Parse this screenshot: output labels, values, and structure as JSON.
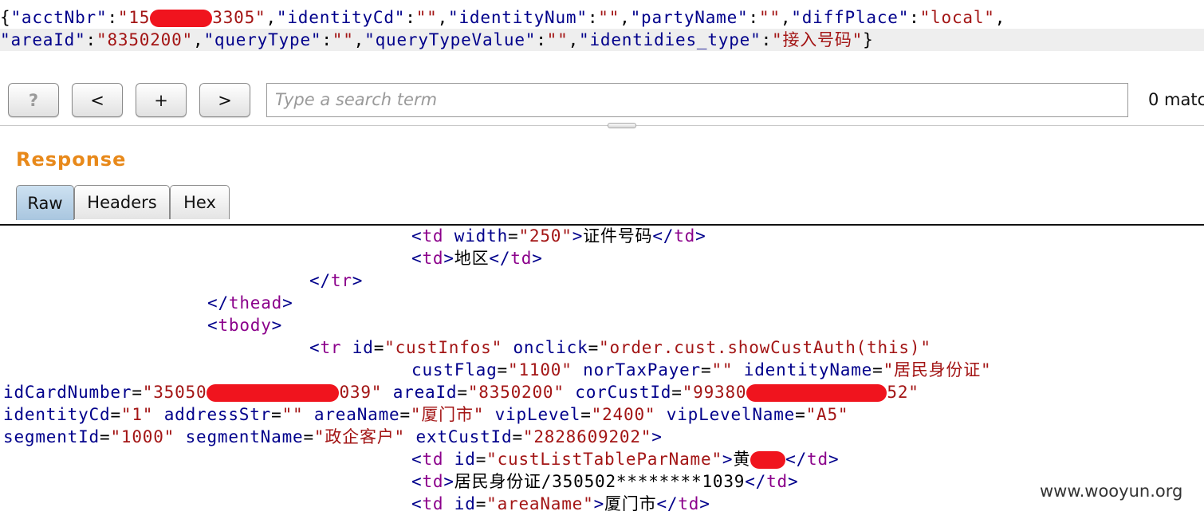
{
  "request": {
    "line1": [
      {
        "t": "{",
        "c": "p"
      },
      {
        "t": "\"acctNbr\"",
        "c": "k"
      },
      {
        "t": ":",
        "c": "p"
      },
      {
        "t": "\"15",
        "c": "v"
      },
      {
        "redact": true,
        "w": 78
      },
      {
        "t": "3305\"",
        "c": "v"
      },
      {
        "t": ",",
        "c": "p"
      },
      {
        "t": "\"identityCd\"",
        "c": "k"
      },
      {
        "t": ":",
        "c": "p"
      },
      {
        "t": "\"\"",
        "c": "v"
      },
      {
        "t": ",",
        "c": "p"
      },
      {
        "t": "\"identityNum\"",
        "c": "k"
      },
      {
        "t": ":",
        "c": "p"
      },
      {
        "t": "\"\"",
        "c": "v"
      },
      {
        "t": ",",
        "c": "p"
      },
      {
        "t": "\"partyName\"",
        "c": "k"
      },
      {
        "t": ":",
        "c": "p"
      },
      {
        "t": "\"\"",
        "c": "v"
      },
      {
        "t": ",",
        "c": "p"
      },
      {
        "t": "\"diffPlace\"",
        "c": "k"
      },
      {
        "t": ":",
        "c": "p"
      },
      {
        "t": "\"local\"",
        "c": "v"
      },
      {
        "t": ",",
        "c": "p"
      }
    ],
    "line2": [
      {
        "t": "\"areaId\"",
        "c": "k"
      },
      {
        "t": ":",
        "c": "p"
      },
      {
        "t": "\"8350200\"",
        "c": "v"
      },
      {
        "t": ",",
        "c": "p"
      },
      {
        "t": "\"queryType\"",
        "c": "k"
      },
      {
        "t": ":",
        "c": "p"
      },
      {
        "t": "\"\"",
        "c": "v"
      },
      {
        "t": ",",
        "c": "p"
      },
      {
        "t": "\"queryTypeValue\"",
        "c": "k"
      },
      {
        "t": ":",
        "c": "p"
      },
      {
        "t": "\"\"",
        "c": "v"
      },
      {
        "t": ",",
        "c": "p"
      },
      {
        "t": "\"identidies_type\"",
        "c": "k"
      },
      {
        "t": ":",
        "c": "p"
      },
      {
        "t": "\"接入号码\"",
        "c": "v"
      },
      {
        "t": "}",
        "c": "p"
      }
    ]
  },
  "toolbar": {
    "help_label": "?",
    "prev_label": "<",
    "add_label": "+",
    "next_label": ">",
    "search_placeholder": "Type a search term",
    "matches_text": "0 matc"
  },
  "response": {
    "title": "Response",
    "tabs": [
      "Raw",
      "Headers",
      "Hex"
    ],
    "active_tab": "Raw",
    "code_lines": [
      [
        {
          "t": "<",
          "c": "tag"
        },
        {
          "t": "td",
          "c": "tn"
        },
        {
          "t": " "
        },
        {
          "t": "width",
          "c": "an"
        },
        {
          "t": "=",
          "c": "p"
        },
        {
          "t": "\"250\"",
          "c": "av"
        },
        {
          "t": ">",
          "c": "tag"
        },
        {
          "t": "证件号码",
          "c": "p"
        },
        {
          "t": "</",
          "c": "tag"
        },
        {
          "t": "td",
          "c": "tn"
        },
        {
          "t": ">",
          "c": "tag"
        }
      ],
      [
        {
          "t": "<",
          "c": "tag"
        },
        {
          "t": "td",
          "c": "tn"
        },
        {
          "t": ">",
          "c": "tag"
        },
        {
          "t": "地区",
          "c": "p"
        },
        {
          "t": "</",
          "c": "tag"
        },
        {
          "t": "td",
          "c": "tn"
        },
        {
          "t": ">",
          "c": "tag"
        }
      ],
      [
        {
          "t": "</",
          "c": "tag"
        },
        {
          "t": "tr",
          "c": "tn"
        },
        {
          "t": ">",
          "c": "tag"
        }
      ],
      [
        {
          "t": "</",
          "c": "tag"
        },
        {
          "t": "thead",
          "c": "tn"
        },
        {
          "t": ">",
          "c": "tag"
        }
      ],
      [
        {
          "t": "<",
          "c": "tag"
        },
        {
          "t": "tbody",
          "c": "tn"
        },
        {
          "t": ">",
          "c": "tag"
        }
      ],
      [
        {
          "t": "<",
          "c": "tag"
        },
        {
          "t": "tr",
          "c": "tn"
        },
        {
          "t": " "
        },
        {
          "t": "id",
          "c": "an"
        },
        {
          "t": "=",
          "c": "p"
        },
        {
          "t": "\"custInfos\"",
          "c": "av"
        },
        {
          "t": " "
        },
        {
          "t": "onclick",
          "c": "an"
        },
        {
          "t": "=",
          "c": "p"
        },
        {
          "t": "\"order.cust.showCustAuth(this)\"",
          "c": "av"
        }
      ],
      [
        {
          "t": "custFlag",
          "c": "an"
        },
        {
          "t": "=",
          "c": "p"
        },
        {
          "t": "\"1100\"",
          "c": "av"
        },
        {
          "t": " "
        },
        {
          "t": "norTaxPayer",
          "c": "an"
        },
        {
          "t": "=",
          "c": "p"
        },
        {
          "t": "\"\"",
          "c": "av"
        },
        {
          "t": " "
        },
        {
          "t": "identityName",
          "c": "an"
        },
        {
          "t": "=",
          "c": "p"
        },
        {
          "t": "\"居民身份证\"",
          "c": "av"
        }
      ],
      [
        {
          "t": "idCardNumber",
          "c": "an"
        },
        {
          "t": "=",
          "c": "p"
        },
        {
          "t": "\"35050",
          "c": "av"
        },
        {
          "redact": true,
          "w": 166
        },
        {
          "t": "039\"",
          "c": "av"
        },
        {
          "t": " "
        },
        {
          "t": "areaId",
          "c": "an"
        },
        {
          "t": "=",
          "c": "p"
        },
        {
          "t": "\"8350200\"",
          "c": "av"
        },
        {
          "t": " "
        },
        {
          "t": "corCustId",
          "c": "an"
        },
        {
          "t": "=",
          "c": "p"
        },
        {
          "t": "\"99380",
          "c": "av"
        },
        {
          "redact": true,
          "w": 176
        },
        {
          "t": "52\"",
          "c": "av"
        }
      ],
      [
        {
          "t": "identityCd",
          "c": "an"
        },
        {
          "t": "=",
          "c": "p"
        },
        {
          "t": "\"1\"",
          "c": "av"
        },
        {
          "t": " "
        },
        {
          "t": "addressStr",
          "c": "an"
        },
        {
          "t": "=",
          "c": "p"
        },
        {
          "t": "\"\"",
          "c": "av"
        },
        {
          "t": " "
        },
        {
          "t": "areaName",
          "c": "an"
        },
        {
          "t": "=",
          "c": "p"
        },
        {
          "t": "\"厦门市\"",
          "c": "av"
        },
        {
          "t": " "
        },
        {
          "t": "vipLevel",
          "c": "an"
        },
        {
          "t": "=",
          "c": "p"
        },
        {
          "t": "\"2400\"",
          "c": "av"
        },
        {
          "t": " "
        },
        {
          "t": "vipLevelName",
          "c": "an"
        },
        {
          "t": "=",
          "c": "p"
        },
        {
          "t": "\"A5\"",
          "c": "av"
        }
      ],
      [
        {
          "t": "segmentId",
          "c": "an"
        },
        {
          "t": "=",
          "c": "p"
        },
        {
          "t": "\"1000\"",
          "c": "av"
        },
        {
          "t": " "
        },
        {
          "t": "segmentName",
          "c": "an"
        },
        {
          "t": "=",
          "c": "p"
        },
        {
          "t": "\"政企客户\"",
          "c": "av"
        },
        {
          "t": " "
        },
        {
          "t": "extCustId",
          "c": "an"
        },
        {
          "t": "=",
          "c": "p"
        },
        {
          "t": "\"2828609202\"",
          "c": "av"
        },
        {
          "t": ">",
          "c": "tag"
        }
      ],
      [
        {
          "t": "<",
          "c": "tag"
        },
        {
          "t": "td",
          "c": "tn"
        },
        {
          "t": " "
        },
        {
          "t": "id",
          "c": "an"
        },
        {
          "t": "=",
          "c": "p"
        },
        {
          "t": "\"custListTableParName\"",
          "c": "av"
        },
        {
          "t": ">",
          "c": "tag"
        },
        {
          "t": "黄",
          "c": "p"
        },
        {
          "redact": true,
          "w": 44
        },
        {
          "t": "</",
          "c": "tag"
        },
        {
          "t": "td",
          "c": "tn"
        },
        {
          "t": ">",
          "c": "tag"
        }
      ],
      [
        {
          "t": "<",
          "c": "tag"
        },
        {
          "t": "td",
          "c": "tn"
        },
        {
          "t": ">",
          "c": "tag"
        },
        {
          "t": "居民身份证/350502********1039",
          "c": "p"
        },
        {
          "t": "</",
          "c": "tag"
        },
        {
          "t": "td",
          "c": "tn"
        },
        {
          "t": ">",
          "c": "tag"
        }
      ],
      [
        {
          "t": "<",
          "c": "tag"
        },
        {
          "t": "td",
          "c": "tn"
        },
        {
          "t": " "
        },
        {
          "t": "id",
          "c": "an"
        },
        {
          "t": "=",
          "c": "p"
        },
        {
          "t": "\"areaName\"",
          "c": "av"
        },
        {
          "t": ">",
          "c": "tag"
        },
        {
          "t": "厦门市",
          "c": "p"
        },
        {
          "t": "</",
          "c": "tag"
        },
        {
          "t": "td",
          "c": "tn"
        },
        {
          "t": ">",
          "c": "tag"
        }
      ]
    ]
  },
  "watermark": "www.wooyun.org"
}
